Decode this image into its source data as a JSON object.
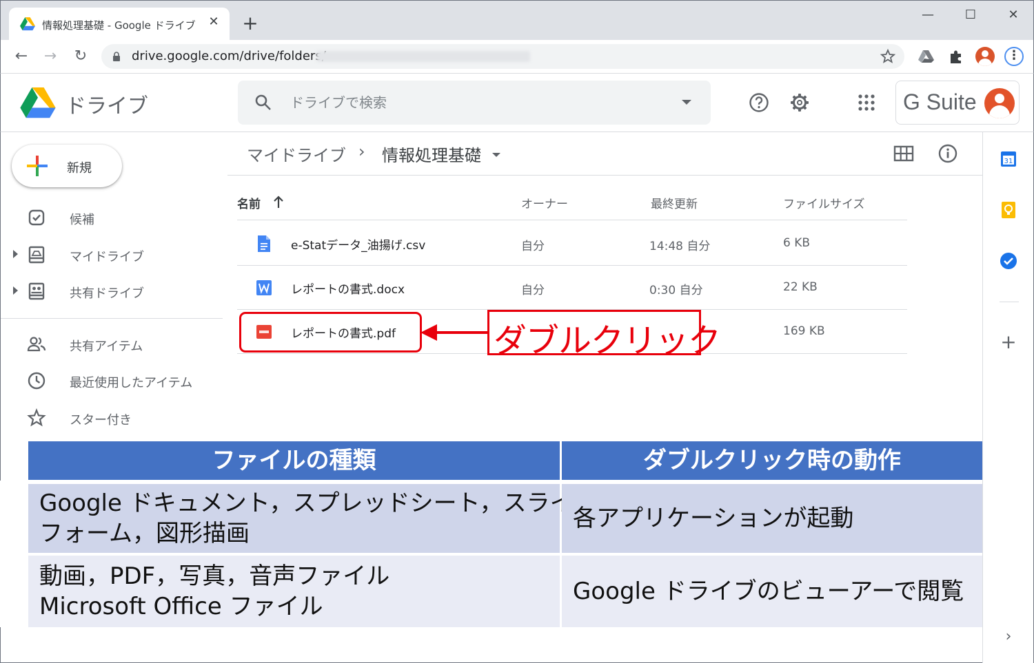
{
  "browser": {
    "tab_title": "情報処理基礎 - Google ドライブ",
    "tab_close": "✕",
    "new_tab": "+",
    "url": "drive.google.com/drive/folders/",
    "window_controls": {
      "minimize": "—",
      "maximize": "☐",
      "close": "✕"
    }
  },
  "drive": {
    "app_name": "ドライブ",
    "search_placeholder": "ドライブで検索",
    "gsuite_label": "G Suite"
  },
  "sidebar": {
    "new_label": "新規",
    "items": [
      {
        "label": "候補",
        "icon": "check-square-icon"
      },
      {
        "label": "マイドライブ",
        "icon": "my-drive-icon"
      },
      {
        "label": "共有ドライブ",
        "icon": "shared-drive-icon"
      },
      {
        "label": "共有アイテム",
        "icon": "people-icon"
      },
      {
        "label": "最近使用したアイテム",
        "icon": "clock-icon"
      },
      {
        "label": "スター付き",
        "icon": "star-icon"
      }
    ]
  },
  "breadcrumb": {
    "root": "マイドライブ",
    "separator": "›",
    "current": "情報処理基礎"
  },
  "table": {
    "headers": {
      "name": "名前",
      "owner": "オーナー",
      "modified": "最終更新",
      "size": "ファイルサイズ"
    },
    "files": [
      {
        "name": "e-Statデータ_油揚げ.csv",
        "owner": "自分",
        "modified": "14:48 自分",
        "size": "6 KB",
        "icon": "sheet-file-icon"
      },
      {
        "name": "レポートの書式.docx",
        "owner": "自分",
        "modified": "0:30 自分",
        "size": "22 KB",
        "icon": "word-file-icon"
      },
      {
        "name": "レポートの書式.pdf",
        "owner": "",
        "modified": "",
        "size": "169 KB",
        "icon": "pdf-file-icon"
      }
    ]
  },
  "annotation": {
    "callout": "ダブルクリック"
  },
  "info_table": {
    "headers": [
      "ファイルの種類",
      "ダブルクリック時の動作"
    ],
    "rows": [
      {
        "type_line1": "Google ドキュメント，スプレッドシート，スライド",
        "type_line2": "フォーム，図形描画",
        "action": "各アプリケーションが起動"
      },
      {
        "type_line1": "動画，PDF，写真，音声ファイル",
        "type_line2": "Microsoft Office ファイル",
        "action": "Google ドライブのビューアーで閲覧"
      }
    ]
  },
  "colors": {
    "accent_red": "#e8000b",
    "table_header_blue": "#4472c4",
    "row_dark": "#cfd5ea",
    "row_light": "#e9ebf5"
  }
}
